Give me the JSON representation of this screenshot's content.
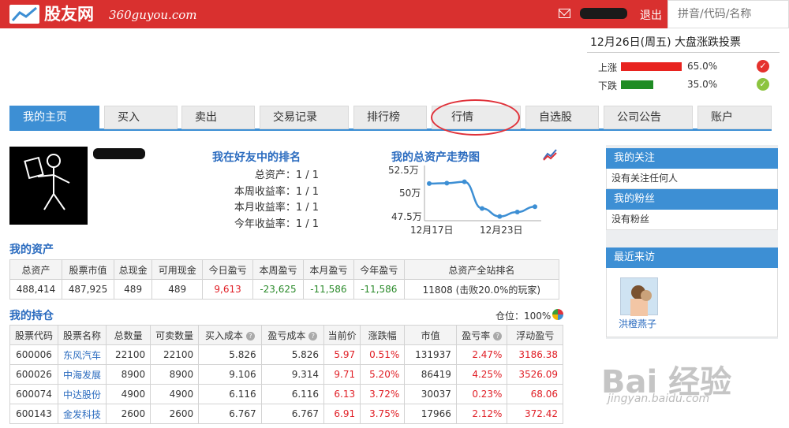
{
  "header": {
    "logo_text": "股友网",
    "logo_domain": "360guyou.com",
    "logout": "退出",
    "search_placeholder": "拼音/代码/名称"
  },
  "vote": {
    "title": "12月26日(周五) 大盘涨跌投票",
    "up_label": "上涨",
    "up_pct": "65.0%",
    "up_value": 65.0,
    "down_label": "下跌",
    "down_pct": "35.0%",
    "down_value": 35.0,
    "up_color": "#e8231f",
    "down_color": "#1f8c24"
  },
  "tabs": [
    "我的主页",
    "买入",
    "卖出",
    "交易记录",
    "排行榜",
    "行情",
    "自选股",
    "公司公告",
    "账户"
  ],
  "ranking": {
    "title": "我在好友中的排名",
    "rows": [
      "总资产：1 / 1",
      "本周收益率：1 / 1",
      "本月收益率：1 / 1",
      "今年收益率：1 / 1"
    ]
  },
  "trend": {
    "title": "我的总资产走势图",
    "y_labels": [
      "52.5万",
      "50万",
      "47.5万"
    ],
    "x_labels": [
      "12月17日",
      "12月23日"
    ]
  },
  "chart_data": {
    "type": "line",
    "title": "我的总资产走势图",
    "x": [
      "12月17日",
      "",
      "",
      "",
      "12月23日",
      "",
      ""
    ],
    "values": [
      51.0,
      51.05,
      51.2,
      48.2,
      47.3,
      47.8,
      48.4
    ],
    "ylim": [
      47.0,
      52.5
    ]
  },
  "assets": {
    "title": "我的资产",
    "headers": [
      "总资产",
      "股票市值",
      "总现金",
      "可用现金",
      "今日盈亏",
      "本周盈亏",
      "本月盈亏",
      "今年盈亏",
      "总资产全站排名"
    ],
    "values": [
      "488,414",
      "487,925",
      "489",
      "489",
      "9,613",
      "-23,625",
      "-11,586",
      "-11,586",
      "11808 (击败20.0%的玩家)"
    ]
  },
  "holdings": {
    "title": "我的持仓",
    "position_label": "仓位：100%",
    "headers": [
      "股票代码",
      "股票名称",
      "总数量",
      "可卖数量",
      "买入成本",
      "盈亏成本",
      "当前价",
      "涨跌幅",
      "市值",
      "盈亏率",
      "浮动盈亏"
    ],
    "rows": [
      [
        "600006",
        "东风汽车",
        "22100",
        "22100",
        "5.826",
        "5.826",
        "5.97",
        "0.51%",
        "131937",
        "2.47%",
        "3186.38"
      ],
      [
        "600026",
        "中海发展",
        "8900",
        "8900",
        "9.106",
        "9.314",
        "9.71",
        "5.20%",
        "86419",
        "4.25%",
        "3526.09"
      ],
      [
        "600074",
        "中达股份",
        "4900",
        "4900",
        "6.116",
        "6.116",
        "6.13",
        "3.72%",
        "30037",
        "0.23%",
        "68.06"
      ],
      [
        "600143",
        "金发科技",
        "2600",
        "2600",
        "6.767",
        "6.767",
        "6.91",
        "3.75%",
        "17966",
        "2.12%",
        "372.42"
      ]
    ]
  },
  "sidebar": {
    "follow_title": "我的关注",
    "follow_empty": "没有关注任何人",
    "fans_title": "我的粉丝",
    "fans_empty": "没有粉丝",
    "visitors_title": "最近来访",
    "visitor_name": "洪橙燕子"
  },
  "watermark": {
    "text": "Bai 经验",
    "url": "jingyan.baidu.com"
  }
}
